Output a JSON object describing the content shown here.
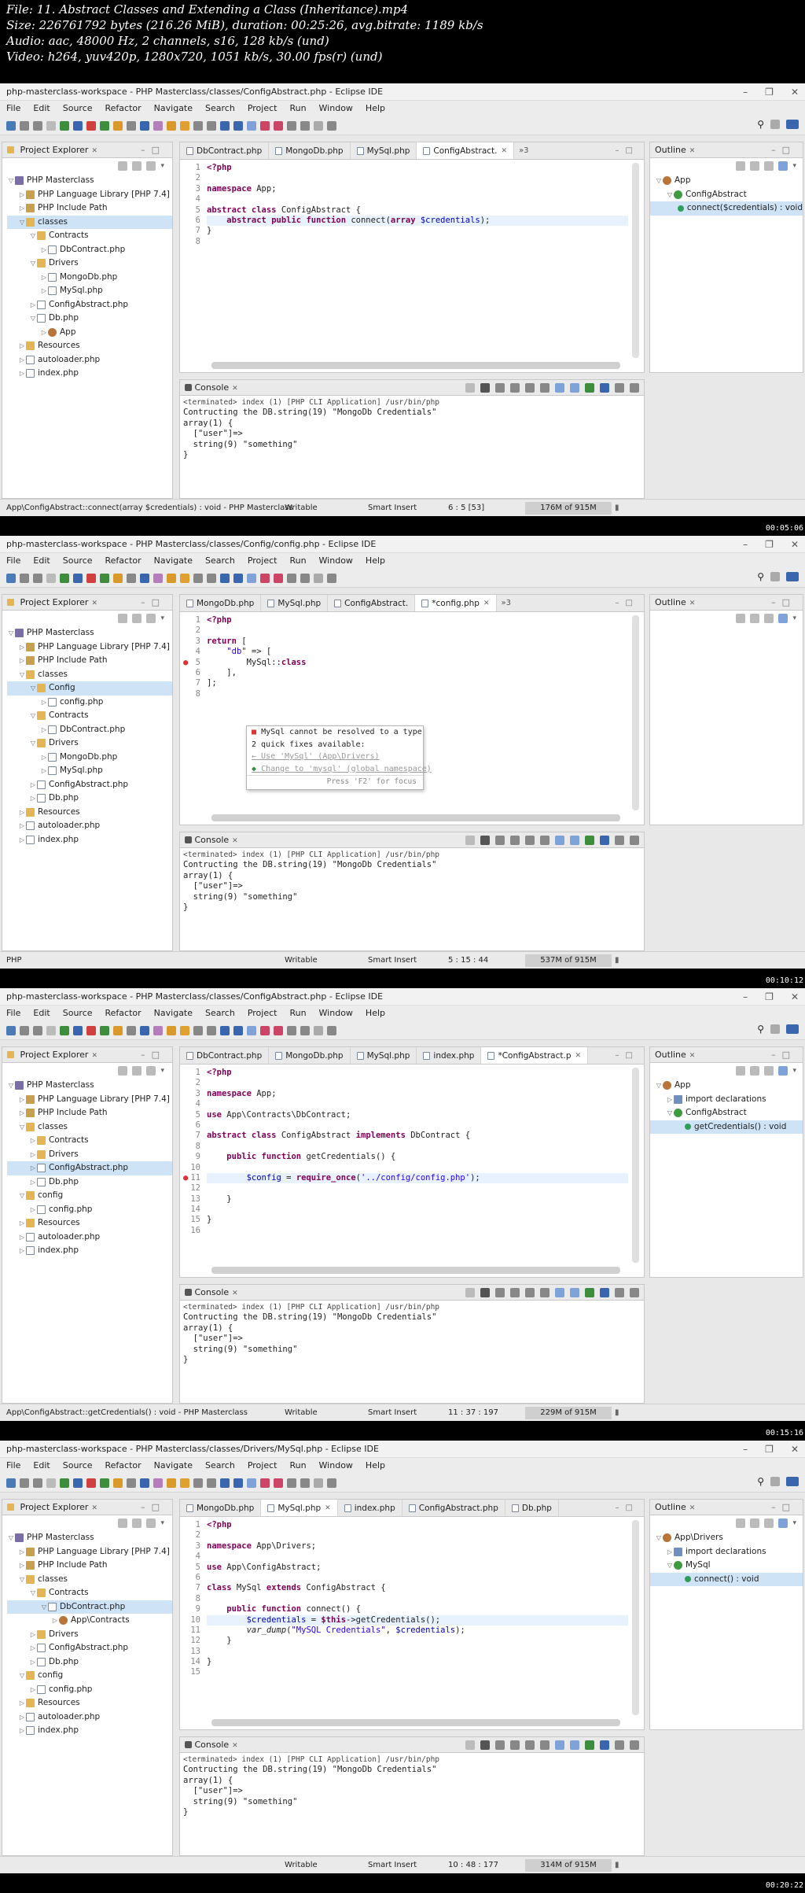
{
  "header": {
    "line1": "File: 11. Abstract Classes and Extending a Class (Inheritance).mp4",
    "line2": "Size: 226761792 bytes (216.26 MiB), duration: 00:25:26, avg.bitrate: 1189 kb/s",
    "line3": "Audio: aac, 48000 Hz, 2 channels, s16, 128 kb/s (und)",
    "line4": "Video: h264, yuv420p, 1280x720, 1051 kb/s, 30.00 fps(r) (und)"
  },
  "menu": [
    "File",
    "Edit",
    "Source",
    "Refactor",
    "Navigate",
    "Search",
    "Project",
    "Run",
    "Window",
    "Help"
  ],
  "panel_labels": {
    "project_explorer": "Project Explorer",
    "outline": "Outline",
    "console": "Console"
  },
  "console_common": {
    "terminated": "<terminated> index (1) [PHP CLI Application] /usr/bin/php",
    "lines": [
      "Contructing the DB.string(19) \"MongoDb Credentials\"",
      "array(1) {",
      "  [\"user\"]=>",
      "  string(9) \"something\"",
      "}"
    ]
  },
  "frames": [
    {
      "title": "php-masterclass-workspace - PHP Masterclass/classes/ConfigAbstract.php - Eclipse IDE",
      "timestamp": "00:05:06",
      "tabs": [
        {
          "label": "DbContract.php",
          "active": false
        },
        {
          "label": "MongoDb.php",
          "active": false
        },
        {
          "label": "MySql.php",
          "active": false
        },
        {
          "label": "ConfigAbstract.",
          "active": true
        }
      ],
      "overflow": "»3",
      "tree": [
        {
          "d": 0,
          "t": "PHP Masterclass",
          "i": "proj",
          "tw": "▽"
        },
        {
          "d": 1,
          "t": "PHP Language Library [PHP 7.4]",
          "i": "lib",
          "tw": "▷"
        },
        {
          "d": 1,
          "t": "PHP Include Path",
          "i": "lib",
          "tw": "▷"
        },
        {
          "d": 1,
          "t": "classes",
          "i": "fold",
          "tw": "▽",
          "sel": true
        },
        {
          "d": 2,
          "t": "Contracts",
          "i": "fold",
          "tw": "▽"
        },
        {
          "d": 3,
          "t": "DbContract.php",
          "i": "file",
          "tw": "▷"
        },
        {
          "d": 2,
          "t": "Drivers",
          "i": "fold",
          "tw": "▽"
        },
        {
          "d": 3,
          "t": "MongoDb.php",
          "i": "file",
          "tw": "▷"
        },
        {
          "d": 3,
          "t": "MySql.php",
          "i": "file",
          "tw": "▷"
        },
        {
          "d": 2,
          "t": "ConfigAbstract.php",
          "i": "file",
          "tw": "▷"
        },
        {
          "d": 2,
          "t": "Db.php",
          "i": "file",
          "tw": "▽"
        },
        {
          "d": 3,
          "t": "App",
          "i": "ns",
          "tw": "▷"
        },
        {
          "d": 1,
          "t": "Resources",
          "i": "fold",
          "tw": "▷"
        },
        {
          "d": 1,
          "t": "autoloader.php",
          "i": "file",
          "tw": "▷"
        },
        {
          "d": 1,
          "t": "index.php",
          "i": "file",
          "tw": "▷"
        }
      ],
      "outline": [
        {
          "d": 0,
          "t": "App",
          "i": "ns",
          "tw": "▽"
        },
        {
          "d": 1,
          "t": "ConfigAbstract",
          "i": "cls",
          "tw": "▽"
        },
        {
          "d": 2,
          "t": "connect($credentials) : void",
          "i": "fn",
          "tw": "",
          "sel": true
        }
      ],
      "code": [
        {
          "n": "1",
          "t": "<?php",
          "k": "kw"
        },
        {
          "n": "2",
          "t": ""
        },
        {
          "n": "3",
          "t": "namespace App;",
          "html": "<span class='kw'>namespace</span> App;"
        },
        {
          "n": "4",
          "t": ""
        },
        {
          "n": "5",
          "t": "abstract class ConfigAbstract {",
          "html": "<span class='kw'>abstract class</span> ConfigAbstract {"
        },
        {
          "n": "6",
          "t": "    abstract public function connect(array $credentials);",
          "html": "    <span class='kw'>abstract public function</span> connect(<span class='kw'>array</span> <span class='var'>$credentials</span>);",
          "hl": true
        },
        {
          "n": "7",
          "t": "}"
        },
        {
          "n": "8",
          "t": ""
        }
      ],
      "status": {
        "left": "App\\ConfigAbstract::connect(array $credentials) : void - PHP Masterclass",
        "writable": "Writable",
        "insert": "Smart Insert",
        "pos": "6 : 5 [53]",
        "heap": "176M of 915M"
      }
    },
    {
      "title": "php-masterclass-workspace - PHP Masterclass/classes/Config/config.php - Eclipse IDE",
      "timestamp": "00:10:12",
      "tabs": [
        {
          "label": "MongoDb.php",
          "active": false
        },
        {
          "label": "MySql.php",
          "active": false
        },
        {
          "label": "ConfigAbstract.",
          "active": false
        },
        {
          "label": "*config.php",
          "active": true
        }
      ],
      "overflow": "»3",
      "tree": [
        {
          "d": 0,
          "t": "PHP Masterclass",
          "i": "proj",
          "tw": "▽"
        },
        {
          "d": 1,
          "t": "PHP Language Library [PHP 7.4]",
          "i": "lib",
          "tw": "▷"
        },
        {
          "d": 1,
          "t": "PHP Include Path",
          "i": "lib",
          "tw": "▷"
        },
        {
          "d": 1,
          "t": "classes",
          "i": "fold",
          "tw": "▽"
        },
        {
          "d": 2,
          "t": "Config",
          "i": "fold",
          "tw": "▽",
          "sel": true
        },
        {
          "d": 3,
          "t": "config.php",
          "i": "file",
          "tw": "▷"
        },
        {
          "d": 2,
          "t": "Contracts",
          "i": "fold",
          "tw": "▽"
        },
        {
          "d": 3,
          "t": "DbContract.php",
          "i": "file",
          "tw": "▷"
        },
        {
          "d": 2,
          "t": "Drivers",
          "i": "fold",
          "tw": "▽"
        },
        {
          "d": 3,
          "t": "MongoDb.php",
          "i": "file",
          "tw": "▷"
        },
        {
          "d": 3,
          "t": "MySql.php",
          "i": "file",
          "tw": "▷"
        },
        {
          "d": 2,
          "t": "ConfigAbstract.php",
          "i": "file",
          "tw": "▷"
        },
        {
          "d": 2,
          "t": "Db.php",
          "i": "file",
          "tw": "▷"
        },
        {
          "d": 1,
          "t": "Resources",
          "i": "fold",
          "tw": "▷"
        },
        {
          "d": 1,
          "t": "autoloader.php",
          "i": "file",
          "tw": "▷"
        },
        {
          "d": 1,
          "t": "index.php",
          "i": "file",
          "tw": "▷"
        }
      ],
      "outline": [],
      "code": [
        {
          "n": "1",
          "t": "<?php",
          "k": "kw"
        },
        {
          "n": "2",
          "t": ""
        },
        {
          "n": "3",
          "t": "return [",
          "html": "<span class='kw'>return</span> ["
        },
        {
          "n": "4",
          "t": "    \"db\" => [",
          "html": "    <span class='str'>\"db\"</span> => ["
        },
        {
          "n": "5",
          "t": "        MySql::class",
          "html": "        MySql::<span class='kw'>class</span>",
          "err": true
        },
        {
          "n": "6",
          "t": "    ],"
        },
        {
          "n": "7",
          "t": "];"
        },
        {
          "n": "8",
          "t": ""
        }
      ],
      "quickfix": {
        "title": "MySql cannot be resolved to a type",
        "sub": "2 quick fixes available:",
        "opt1": "Use 'MySql' (App\\Drivers)",
        "opt2": "Change to 'mysql' (global namespace)",
        "hint": "Press 'F2' for focus"
      },
      "status": {
        "left": "PHP",
        "writable": "Writable",
        "insert": "Smart Insert",
        "pos": "5 : 15 : 44",
        "heap": "537M of 915M"
      }
    },
    {
      "title": "php-masterclass-workspace - PHP Masterclass/classes/ConfigAbstract.php - Eclipse IDE",
      "timestamp": "00:15:16",
      "tabs": [
        {
          "label": "DbContract.php",
          "active": false
        },
        {
          "label": "MongoDb.php",
          "active": false
        },
        {
          "label": "MySql.php",
          "active": false
        },
        {
          "label": "index.php",
          "active": false
        },
        {
          "label": "*ConfigAbstract.p",
          "active": true
        }
      ],
      "overflow": "",
      "tree": [
        {
          "d": 0,
          "t": "PHP Masterclass",
          "i": "proj",
          "tw": "▽"
        },
        {
          "d": 1,
          "t": "PHP Language Library [PHP 7.4]",
          "i": "lib",
          "tw": "▷"
        },
        {
          "d": 1,
          "t": "PHP Include Path",
          "i": "lib",
          "tw": "▷"
        },
        {
          "d": 1,
          "t": "classes",
          "i": "fold",
          "tw": "▽"
        },
        {
          "d": 2,
          "t": "Contracts",
          "i": "fold",
          "tw": "▷"
        },
        {
          "d": 2,
          "t": "Drivers",
          "i": "fold",
          "tw": "▷"
        },
        {
          "d": 2,
          "t": "ConfigAbstract.php",
          "i": "file",
          "tw": "▷",
          "sel": true
        },
        {
          "d": 2,
          "t": "Db.php",
          "i": "file",
          "tw": "▷"
        },
        {
          "d": 1,
          "t": "config",
          "i": "fold",
          "tw": "▽"
        },
        {
          "d": 2,
          "t": "config.php",
          "i": "file",
          "tw": "▷"
        },
        {
          "d": 1,
          "t": "Resources",
          "i": "fold",
          "tw": "▷"
        },
        {
          "d": 1,
          "t": "autoloader.php",
          "i": "file",
          "tw": "▷"
        },
        {
          "d": 1,
          "t": "index.php",
          "i": "file",
          "tw": "▷"
        }
      ],
      "outline": [
        {
          "d": 0,
          "t": "App",
          "i": "ns",
          "tw": "▽"
        },
        {
          "d": 1,
          "t": "import declarations",
          "i": "imp",
          "tw": "▷"
        },
        {
          "d": 1,
          "t": "ConfigAbstract",
          "i": "cls",
          "tw": "▽"
        },
        {
          "d": 2,
          "t": "getCredentials() : void",
          "i": "fn",
          "tw": "",
          "sel": true
        }
      ],
      "code": [
        {
          "n": "1",
          "t": "<?php",
          "k": "kw"
        },
        {
          "n": "2",
          "t": ""
        },
        {
          "n": "3",
          "t": "namespace App;",
          "html": "<span class='kw'>namespace</span> App;"
        },
        {
          "n": "4",
          "t": ""
        },
        {
          "n": "5",
          "t": "use App\\Contracts\\DbContract;",
          "html": "<span class='kw'>use</span> App\\Contracts\\DbContract;"
        },
        {
          "n": "6",
          "t": ""
        },
        {
          "n": "7",
          "t": "abstract class ConfigAbstract implements DbContract {",
          "html": "<span class='kw'>abstract class</span> ConfigAbstract <span class='kw'>implements</span> DbContract {"
        },
        {
          "n": "8",
          "t": ""
        },
        {
          "n": "9",
          "t": "    public function getCredentials() {",
          "html": "    <span class='kw'>public function</span> getCredentials() {"
        },
        {
          "n": "10",
          "t": ""
        },
        {
          "n": "11",
          "t": "        $config = require_once('../config/config.php');",
          "html": "        <span class='var'>$config</span> = <span class='kw'>require_once</span>(<span class='str'>'../config/config.php'</span>);",
          "hl": true,
          "err": true
        },
        {
          "n": "12",
          "t": ""
        },
        {
          "n": "13",
          "t": "    }"
        },
        {
          "n": "14",
          "t": ""
        },
        {
          "n": "15",
          "t": "}"
        },
        {
          "n": "16",
          "t": ""
        }
      ],
      "status": {
        "left": "App\\ConfigAbstract::getCredentials() : void - PHP Masterclass",
        "writable": "Writable",
        "insert": "Smart Insert",
        "pos": "11 : 37 : 197",
        "heap": "229M of 915M"
      }
    },
    {
      "title": "php-masterclass-workspace - PHP Masterclass/classes/Drivers/MySql.php - Eclipse IDE",
      "timestamp": "00:20:22",
      "tabs": [
        {
          "label": "MongoDb.php",
          "active": false
        },
        {
          "label": "MySql.php",
          "active": true
        },
        {
          "label": "index.php",
          "active": false
        },
        {
          "label": "ConfigAbstract.php",
          "active": false
        },
        {
          "label": "Db.php",
          "active": false
        }
      ],
      "overflow": "",
      "tree": [
        {
          "d": 0,
          "t": "PHP Masterclass",
          "i": "proj",
          "tw": "▽"
        },
        {
          "d": 1,
          "t": "PHP Language Library [PHP 7.4]",
          "i": "lib",
          "tw": "▷"
        },
        {
          "d": 1,
          "t": "PHP Include Path",
          "i": "lib",
          "tw": "▷"
        },
        {
          "d": 1,
          "t": "classes",
          "i": "fold",
          "tw": "▽"
        },
        {
          "d": 2,
          "t": "Contracts",
          "i": "fold",
          "tw": "▽"
        },
        {
          "d": 3,
          "t": "DbContract.php",
          "i": "file",
          "tw": "▽",
          "sel": true
        },
        {
          "d": 4,
          "t": "App\\Contracts",
          "i": "ns",
          "tw": "▷"
        },
        {
          "d": 2,
          "t": "Drivers",
          "i": "fold",
          "tw": "▷"
        },
        {
          "d": 2,
          "t": "ConfigAbstract.php",
          "i": "file",
          "tw": "▷"
        },
        {
          "d": 2,
          "t": "Db.php",
          "i": "file",
          "tw": "▷"
        },
        {
          "d": 1,
          "t": "config",
          "i": "fold",
          "tw": "▽"
        },
        {
          "d": 2,
          "t": "config.php",
          "i": "file",
          "tw": "▷"
        },
        {
          "d": 1,
          "t": "Resources",
          "i": "fold",
          "tw": "▷"
        },
        {
          "d": 1,
          "t": "autoloader.php",
          "i": "file",
          "tw": "▷"
        },
        {
          "d": 1,
          "t": "index.php",
          "i": "file",
          "tw": "▷"
        }
      ],
      "outline": [
        {
          "d": 0,
          "t": "App\\Drivers",
          "i": "ns",
          "tw": "▽"
        },
        {
          "d": 1,
          "t": "import declarations",
          "i": "imp",
          "tw": "▷"
        },
        {
          "d": 1,
          "t": "MySql",
          "i": "cls",
          "tw": "▽"
        },
        {
          "d": 2,
          "t": "connect() : void",
          "i": "fn",
          "tw": "",
          "sel": true
        }
      ],
      "code": [
        {
          "n": "1",
          "t": "<?php",
          "k": "kw"
        },
        {
          "n": "2",
          "t": ""
        },
        {
          "n": "3",
          "t": "namespace App\\Drivers;",
          "html": "<span class='kw'>namespace</span> App\\Drivers;"
        },
        {
          "n": "4",
          "t": ""
        },
        {
          "n": "5",
          "t": "use App\\ConfigAbstract;",
          "html": "<span class='kw'>use</span> App\\ConfigAbstract;"
        },
        {
          "n": "6",
          "t": ""
        },
        {
          "n": "7",
          "t": "class MySql extends ConfigAbstract {",
          "html": "<span class='kw'>class</span> MySql <span class='kw'>extends</span> ConfigAbstract {"
        },
        {
          "n": "8",
          "t": ""
        },
        {
          "n": "9",
          "t": "    public function connect() {",
          "html": "    <span class='kw'>public function</span> connect() {"
        },
        {
          "n": "10",
          "t": "        $credentials = $this->getCredentials();",
          "html": "        <span class='var'>$credentials</span> = <span class='kw'>$this</span>->getCredentials();",
          "hl": true
        },
        {
          "n": "11",
          "t": "        var_dump(\"MySQL Credentials\", $credentials);",
          "html": "        <span class='it'>var_dump</span>(<span class='str'>\"MySQL Credentials\"</span>, <span class='var'>$credentials</span>);"
        },
        {
          "n": "12",
          "t": "    }"
        },
        {
          "n": "13",
          "t": ""
        },
        {
          "n": "14",
          "t": "}"
        },
        {
          "n": "15",
          "t": ""
        }
      ],
      "status": {
        "left": "",
        "writable": "Writable",
        "insert": "Smart Insert",
        "pos": "10 : 48 : 177",
        "heap": "314M of 915M"
      }
    }
  ]
}
